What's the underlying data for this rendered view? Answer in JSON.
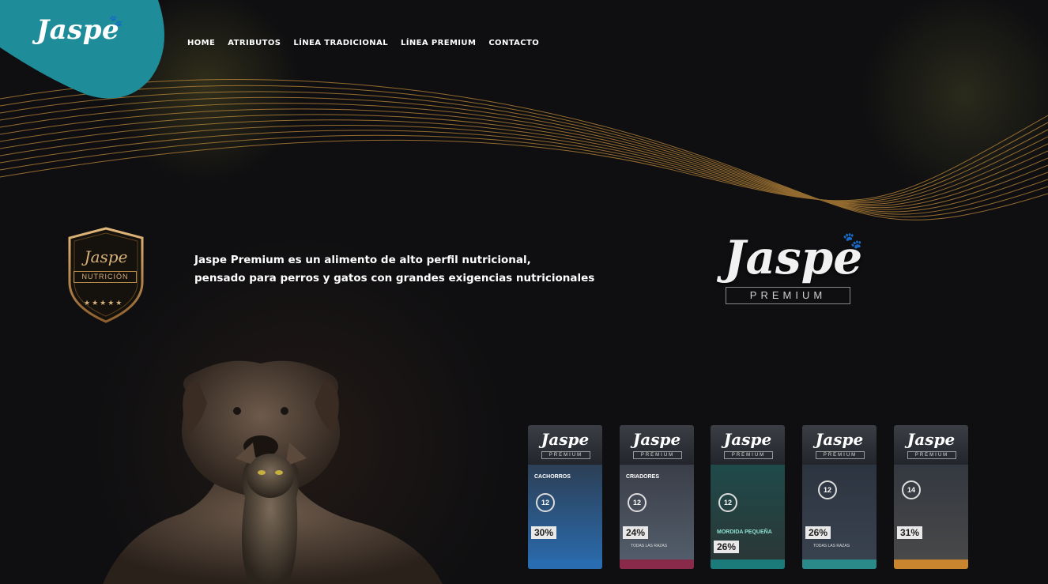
{
  "brand": {
    "logo": "Jaspe",
    "accent": "#1f8d99",
    "gold": "#c79a52"
  },
  "nav": [
    "HOME",
    "ATRIBUTOS",
    "LÍNEA TRADICIONAL",
    "LÍNEA PREMIUM",
    "CONTACTO"
  ],
  "badge": {
    "title": "Jaspe",
    "subtitle": "NUTRICIÓN",
    "stars": "★★★★★"
  },
  "tagline": {
    "line1": "Jaspe Premium es un alimento de alto perfil nutricional,",
    "line2": "pensado para perros y gatos con grandes exigencias nutricionales"
  },
  "premium_logo": {
    "name": "Jaspe",
    "sub": "PREMIUM"
  },
  "bags": [
    {
      "logo": "Jaspe",
      "brand": "PREMIUM",
      "variant": "CACHORROS",
      "pct": "30%",
      "age": "12",
      "color": "#2a6cb0",
      "foot": ""
    },
    {
      "logo": "Jaspe",
      "brand": "PREMIUM",
      "variant": "CRIADORES",
      "pct": "24%",
      "age": "12",
      "color": "#8a2a4a",
      "foot": "TODAS LAS RAZAS"
    },
    {
      "logo": "Jaspe",
      "brand": "PREMIUM",
      "variant": "MORDIDA PEQUEÑA",
      "pct": "26%",
      "age": "12",
      "color": "#1b7a7a",
      "foot": ""
    },
    {
      "logo": "Jaspe",
      "brand": "PREMIUM",
      "variant": "",
      "pct": "26%",
      "age": "12",
      "color": "#2a8a8a",
      "foot": "TODAS LAS RAZAS"
    },
    {
      "logo": "Jaspe",
      "brand": "PREMIUM",
      "variant": "",
      "pct": "31%",
      "age": "14",
      "color": "#c8852e",
      "foot": ""
    }
  ]
}
